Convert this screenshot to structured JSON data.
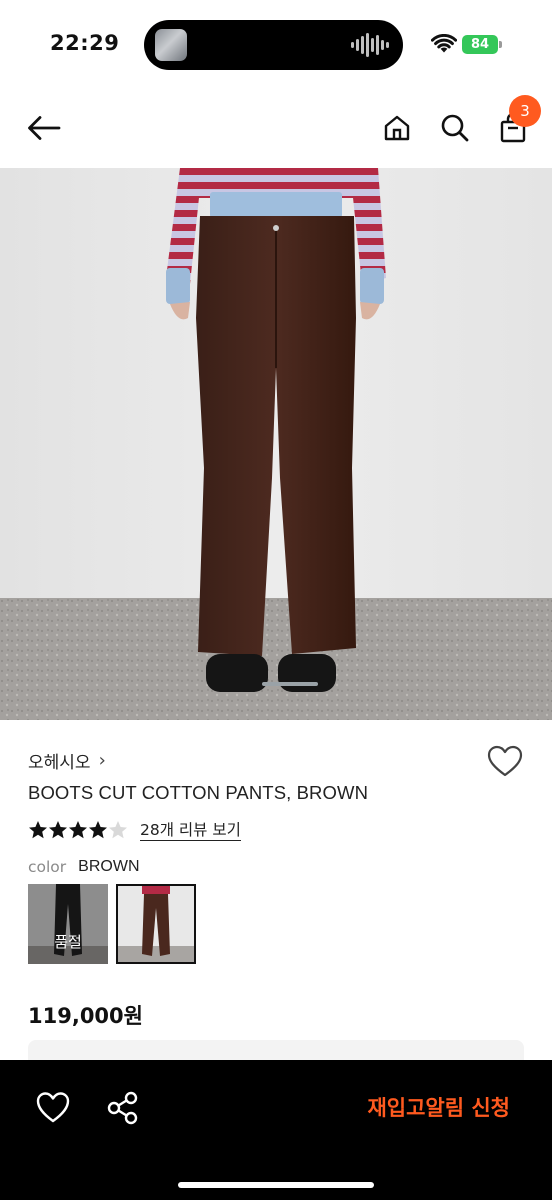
{
  "status_bar": {
    "time": "22:29",
    "battery": "84",
    "wifi_icon": "wifi-icon",
    "battery_color": "#34c759"
  },
  "nav": {
    "back_icon": "arrow-left-icon",
    "home_icon": "home-icon",
    "search_icon": "search-icon",
    "cart_icon": "shopping-bag-icon",
    "cart_count": "3",
    "badge_color": "#ff5a1f"
  },
  "product": {
    "brand": "오헤시오",
    "brand_chevron": "›",
    "name": "BOOTS CUT COTTON PANTS, BROWN",
    "rating": 4.5,
    "review_link": "28개 리뷰 보기",
    "color_label": "color",
    "color_value": "BROWN",
    "options": [
      {
        "name": "swatch-black",
        "status": "품절"
      },
      {
        "name": "swatch-brown",
        "selected": true
      }
    ],
    "price": "119,000원"
  },
  "bottom_bar": {
    "wish_icon": "heart-icon",
    "share_icon": "share-icon",
    "restock_label": "재입고알림 신청",
    "accent_color": "#ff5a1f"
  }
}
